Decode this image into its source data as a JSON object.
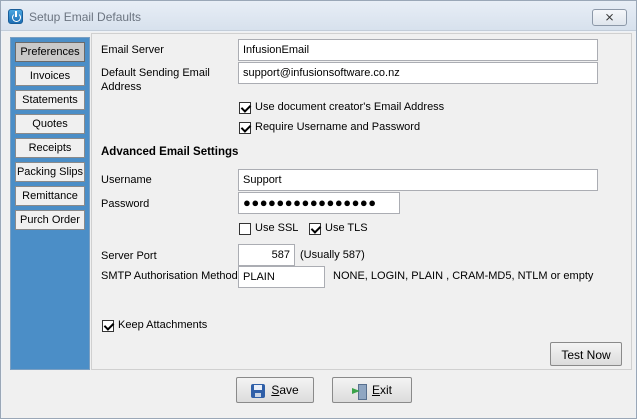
{
  "window": {
    "title": "Setup Email Defaults",
    "close_label": "⨯"
  },
  "sidebar": {
    "items": [
      {
        "label": "Preferences",
        "active": true
      },
      {
        "label": "Invoices"
      },
      {
        "label": "Statements"
      },
      {
        "label": "Quotes"
      },
      {
        "label": "Receipts"
      },
      {
        "label": "Packing Slips"
      },
      {
        "label": "Remittance"
      },
      {
        "label": "Purch Order"
      }
    ]
  },
  "form": {
    "email_server_label": "Email Server",
    "email_server_value": "InfusionEmail",
    "default_sending_label": "Default Sending Email Address",
    "default_sending_value": "support@infusionsoftware.co.nz",
    "use_creator_label": "Use document creator's Email Address",
    "use_creator_checked": true,
    "require_auth_label": "Require Username and Password",
    "require_auth_checked": true,
    "advanced_heading": "Advanced Email Settings",
    "username_label": "Username",
    "username_value": "Support",
    "password_label": "Password",
    "password_value": "●●●●●●●●●●●●●●●●",
    "use_ssl_label": "Use SSL",
    "use_ssl_checked": false,
    "use_tls_label": "Use TLS",
    "use_tls_checked": true,
    "server_port_label": "Server Port",
    "server_port_value": "587",
    "server_port_hint": "(Usually 587)",
    "smtp_auth_label": "SMTP Authorisation Method",
    "smtp_auth_value": "PLAIN",
    "smtp_auth_options": "NONE,  LOGIN,  PLAIN ,  CRAM-MD5,  NTLM or empty",
    "keep_attachments_label": "Keep Attachments",
    "keep_attachments_checked": true,
    "test_now_label": "Test Now"
  },
  "footer": {
    "save_label_first": "S",
    "save_label_rest": "ave",
    "exit_label_first": "E",
    "exit_label_rest": "xit"
  },
  "icons": {
    "app": "app-power-icon",
    "close": "close-icon",
    "save": "floppy-disk-icon",
    "exit": "exit-door-icon"
  }
}
